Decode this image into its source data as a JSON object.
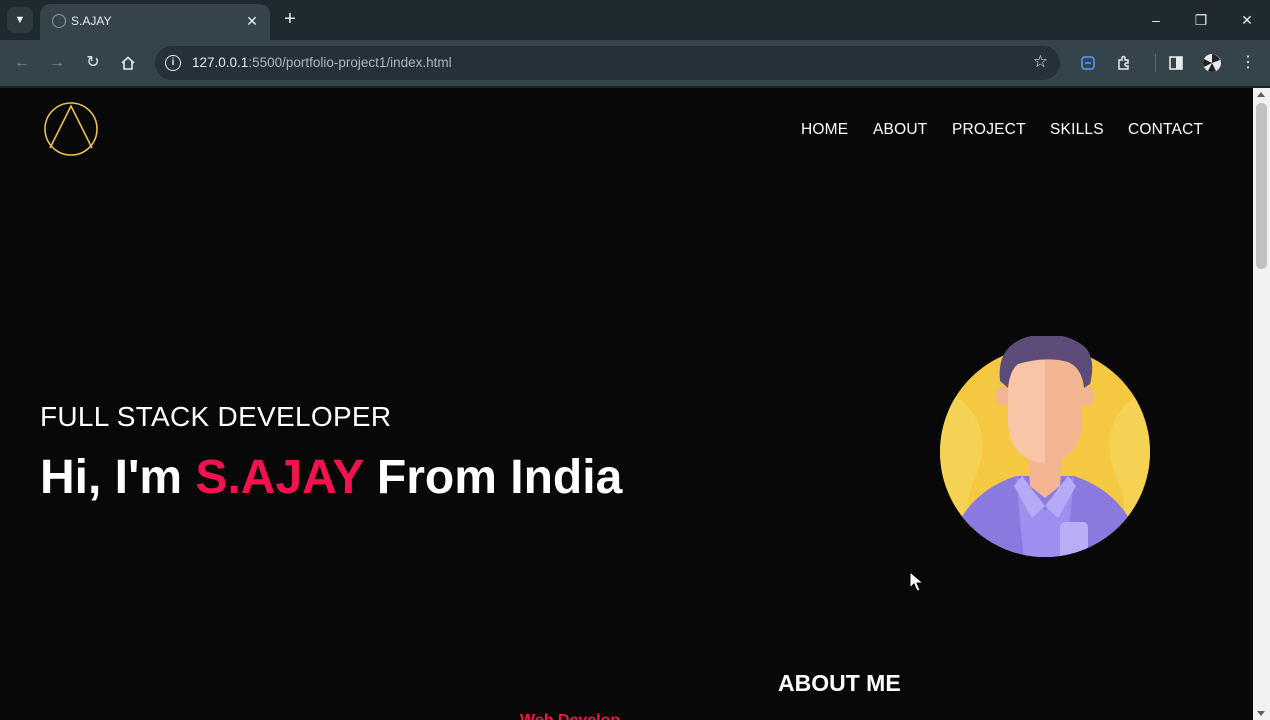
{
  "browser": {
    "tab": {
      "title": "S.AJAY"
    },
    "address": {
      "host": "127.0.0.1",
      "rest": ":5500/portfolio-project1/index.html"
    }
  },
  "page": {
    "nav": [
      "HOME",
      "ABOUT",
      "PROJECT",
      "SKILLS",
      "CONTACT"
    ],
    "hero": {
      "subtitle": "FULL STACK DEVELOPER",
      "greeting": "Hi, I'm",
      "name": "S.AJAY",
      "suffix": "From India"
    },
    "about_heading": "ABOUT ME",
    "peek_text": "Web Develop"
  },
  "colors": {
    "accent": "#f0134d",
    "logo": "#e8c24a",
    "page_bg": "#080809",
    "avatar_bg": "#f5c842"
  },
  "icons": [
    "tab-search-icon",
    "close-icon",
    "plus-icon",
    "minimize-icon",
    "restore-icon",
    "back-icon",
    "forward-icon",
    "reload-icon",
    "home-icon",
    "info-icon",
    "star-icon",
    "extensions-icon",
    "sidepanel-icon",
    "menu-icon"
  ]
}
